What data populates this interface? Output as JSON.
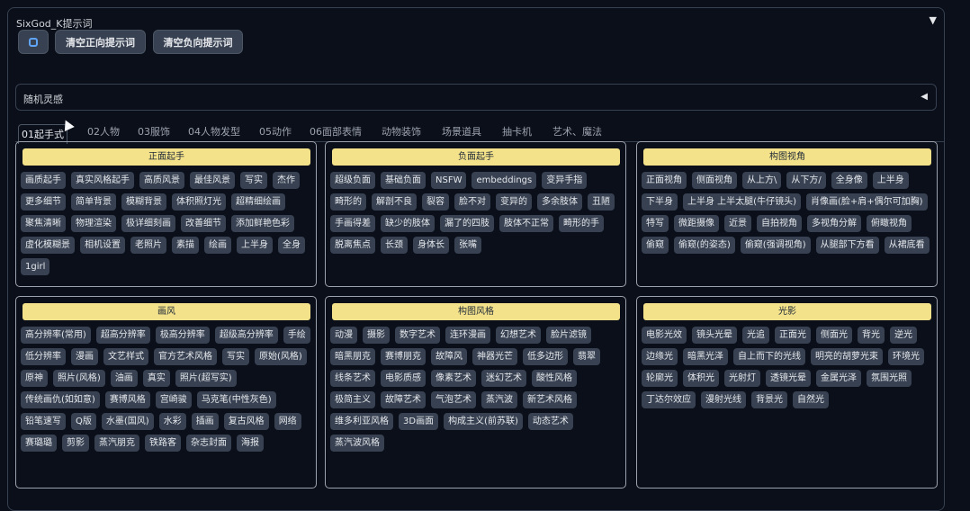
{
  "panel": {
    "title": "SixGod_K提示词",
    "toggle": "▼"
  },
  "toolbar": {
    "settings_icon": "gear-icon",
    "clear_positive": "清空正向提示词",
    "clear_negative": "清空负向提示词"
  },
  "inspiration": {
    "label": "随机灵感",
    "toggle": "◀"
  },
  "tabs": [
    "01起手式",
    "02人物",
    "03服饰",
    "04人物发型",
    "05动作",
    "06面部表情",
    "动物装饰",
    "场景道具",
    "抽卡机",
    "艺术、魔法"
  ],
  "cards": [
    {
      "title": "正面起手",
      "chips": [
        "画质起手",
        "真实风格起手",
        "高质风景",
        "最佳风景",
        "写实",
        "杰作",
        "更多细节",
        "简单背景",
        "模糊背景",
        "体积照灯光",
        "超精细绘画",
        "聚焦清晰",
        "物理渲染",
        "极详细刻画",
        "改善细节",
        "添加鲜艳色彩",
        "虚化模糊景",
        "相机设置",
        "老照片",
        "素描",
        "绘画",
        "上半身",
        "全身",
        "1girl"
      ]
    },
    {
      "title": "负面起手",
      "chips": [
        "超级负面",
        "基础负面",
        "NSFW",
        "embeddings",
        "变异手指",
        "畸形的",
        "解剖不良",
        "裂容",
        "脸不对",
        "变异的",
        "多余肢体",
        "丑陋",
        "手画得差",
        "缺少的肢体",
        "漏了的四肢",
        "肢体不正常",
        "畸形的手",
        "脱离焦点",
        "长颈",
        "身体长",
        "张嘴"
      ]
    },
    {
      "title": "构图视角",
      "chips": [
        "正面视角",
        "侧面视角",
        "从上方\\",
        "从下方/",
        "全身像",
        "上半身",
        "下半身",
        "上半身 上半太腿(牛仔镜头)",
        "肖像画(脸+肩+偶尔可加胸)",
        "特写",
        "微距摄像",
        "近景",
        "自拍视角",
        "多视角分解",
        "俯瞰视角",
        "偷窥",
        "偷窥(的姿态)",
        "偷窥(强调视角)",
        "从腿部下方看",
        "从裙底看"
      ]
    },
    {
      "title": "画风",
      "chips": [
        "高分辨率(常用)",
        "超高分辨率",
        "极高分辨率",
        "超级高分辨率",
        "手绘",
        "低分辨率",
        "漫画",
        "文艺样式",
        "官方艺术风格",
        "写实",
        "原始(风格)",
        "原神",
        "照片(风格)",
        "油画",
        "真实",
        "照片(超写实)",
        "传统画仇(如如意)",
        "赛博风格",
        "宫崎骏",
        "马克笔(中性灰色)",
        "铅笔速写",
        "Q版",
        "水墨(国风)",
        "水彩",
        "插画",
        "复古风格",
        "网络",
        "赛璐璐",
        "剪影",
        "蒸汽朋克",
        "铁路客",
        "杂志封面",
        "海报"
      ]
    },
    {
      "title": "构图风格",
      "chips": [
        "动漫",
        "摄影",
        "数字艺术",
        "连环漫画",
        "幻想艺术",
        "脸片滤镜",
        "暗黑朋克",
        "赛博朋克",
        "故障风",
        "神器光芒",
        "低多边形",
        "翡翠",
        "线条艺术",
        "电影质感",
        "像素艺术",
        "迷幻艺术",
        "酸性风格",
        "极简主义",
        "故障艺术",
        "气泡艺术",
        "蒸汽波",
        "新艺术风格",
        "维多利亚风格",
        "3D画面",
        "构成主义(前苏联)",
        "动态艺术",
        "蒸汽波风格"
      ]
    },
    {
      "title": "光影",
      "chips": [
        "电影光效",
        "镜头光晕",
        "光追",
        "正面光",
        "侧面光",
        "背光",
        "逆光",
        "边缘光",
        "暗黑光泽",
        "自上而下的光线",
        "明亮的胡萝光束",
        "环境光",
        "轮廓光",
        "体积光",
        "光射灯",
        "透镜光晕",
        "金属光泽",
        "氛围光照",
        "丁达尔效应",
        "漫射光线",
        "背景光",
        "自然光"
      ]
    }
  ]
}
